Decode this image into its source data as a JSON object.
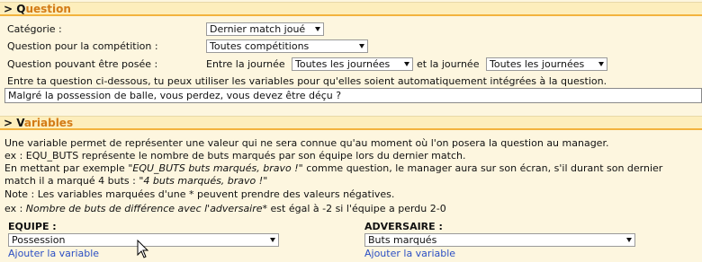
{
  "question_section": {
    "title_first": "> Q",
    "title_rest": "uestion",
    "category_label": "Catégorie :",
    "category_value": "Dernier match joué",
    "competition_label": "Question pour la compétition :",
    "competition_value": "Toutes compétitions",
    "asked_label": "Question pouvant être posée :",
    "between_label": "Entre la journée",
    "start_day_value": "Toutes les journées",
    "and_label": "et la journée",
    "end_day_value": "Toutes les journées",
    "instruction": "Entre ta question ci-dessous, tu peux utiliser les variables pour qu'elles soient automatiquement intégrées à la question.",
    "question_text": "Malgré la possession de balle, vous perdez, vous devez être déçu ?"
  },
  "variables_section": {
    "title_first": "> V",
    "title_rest": "ariables",
    "line1": "Une variable permet de représenter une valeur qui ne sera connue qu'au moment où l'on posera la question au manager.",
    "line2": "ex : EQU_BUTS représente le nombre de buts marqués par son équipe lors du dernier match.",
    "line3_pre": "En mettant par exemple \"",
    "line3_italic": "EQU_BUTS buts marqués, bravo !",
    "line3_post": "\" comme question, le manager aura sur son écran, s'il durant son dernier",
    "line4_pre": "match il a marqué 4 buts : \"",
    "line4_italic": "4 buts marqués, bravo !",
    "line4_post": "\"",
    "line5": "Note : Les variables marquées d'une * peuvent prendre des valeurs négatives.",
    "line6_pre": "ex : ",
    "line6_italic": "Nombre de buts de différence avec l'adversaire",
    "line6_post": "* est égal à -2 si l'équipe a perdu 2-0",
    "team_label": "EQUIPE :",
    "team_value": "Possession",
    "team_add": "Ajouter la variable",
    "opponent_label": "ADVERSAIRE :",
    "opponent_value": "Buts marqués",
    "opponent_add": "Ajouter la variable"
  },
  "colors": {
    "background": "#fdf6df",
    "header_bg": "#fdeebc",
    "header_accent": "#d37b16",
    "header_border": "#f3b33d",
    "link": "#2b4fc4"
  }
}
